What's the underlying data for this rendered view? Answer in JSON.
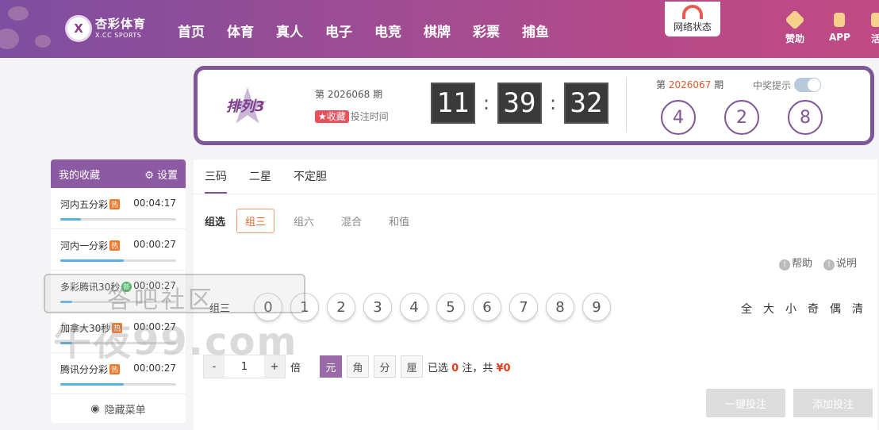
{
  "header": {
    "logo_cn": "杏彩体育",
    "logo_en": "X.CC SPORTS",
    "nav": [
      "首页",
      "体育",
      "真人",
      "电子",
      "电竞",
      "棋牌",
      "彩票",
      "捕鱼"
    ],
    "net_status": "网络状态",
    "right": [
      {
        "label": "赞助",
        "icon": "heart-hand-icon"
      },
      {
        "label": "APP",
        "icon": "phone-icon"
      },
      {
        "label": "活",
        "icon": "gift-icon"
      }
    ]
  },
  "favorites": {
    "title": "我的收藏",
    "settings": "设置",
    "items": [
      {
        "name": "河内五分彩",
        "badge": "热",
        "time": "00:04:17",
        "progress": 0.18
      },
      {
        "name": "河内一分彩",
        "badge": "热",
        "time": "00:00:27",
        "progress": 0.55
      },
      {
        "name": "多彩腾讯30秒",
        "badge": "新",
        "time": "00:00:27",
        "progress": 0.1
      },
      {
        "name": "加拿大30秒",
        "badge": "热",
        "time": "00:00:27",
        "progress": 0.1
      },
      {
        "name": "腾讯分分彩",
        "badge": "热",
        "time": "00:00:27",
        "progress": 0.55
      }
    ],
    "hide_menu": "隐藏菜单"
  },
  "draw": {
    "game_name": "排列3",
    "current_issue_prefix": "第",
    "current_issue": "2026068",
    "current_issue_suffix": "期",
    "fav_tag": "收藏",
    "bet_time": "投注时间",
    "countdown": [
      "11",
      "39",
      "32"
    ],
    "last_issue_prefix": "第",
    "last_issue": "2026067",
    "last_issue_suffix": "期",
    "win_tip": "中奖提示",
    "results": [
      "4",
      "2",
      "8"
    ]
  },
  "bet": {
    "tabs": [
      "三码",
      "二星",
      "不定胆"
    ],
    "sub_lead": "组选",
    "subtabs": [
      "组三",
      "组六",
      "混合",
      "和值"
    ],
    "help": "帮助",
    "explain": "说明",
    "row_label": "组三",
    "numbers": [
      "0",
      "1",
      "2",
      "3",
      "4",
      "5",
      "6",
      "7",
      "8",
      "9"
    ],
    "quick": [
      "全",
      "大",
      "小",
      "奇",
      "偶",
      "清"
    ],
    "multiplier": "1",
    "multiplier_unit": "倍",
    "units": [
      "元",
      "角",
      "分",
      "厘"
    ],
    "selected_prefix": "已选",
    "selected_count": "0",
    "selected_mid": "注，共",
    "selected_amount": "¥0",
    "one_click": "一键投注",
    "add_bet": "添加投注"
  },
  "watermark": {
    "line1": "答吧社区",
    "line2": "午夜99.com"
  }
}
